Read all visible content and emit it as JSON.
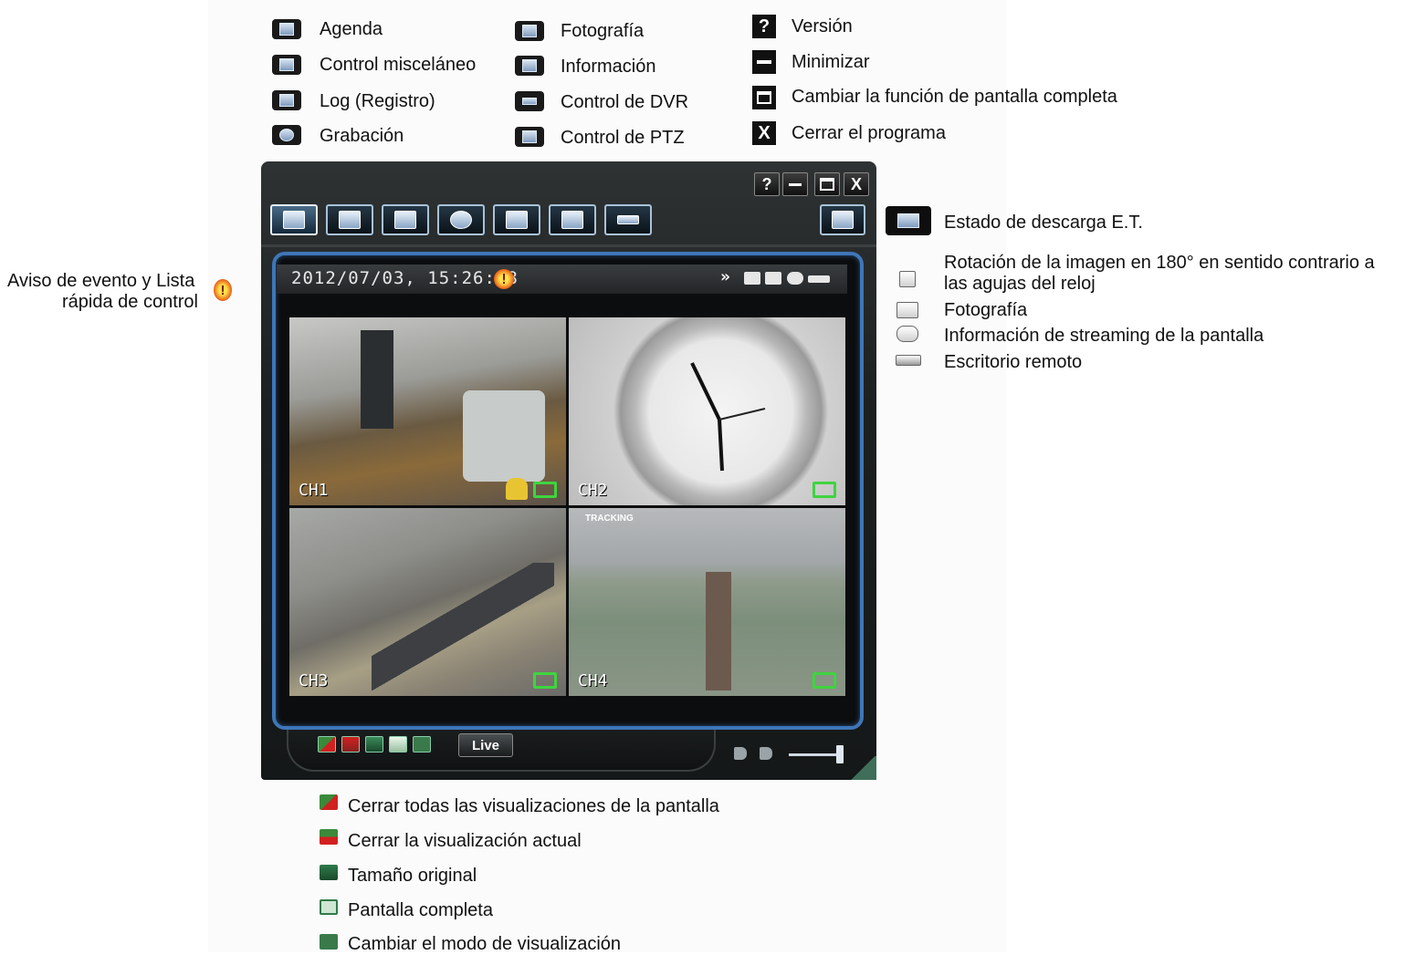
{
  "toolbar_legend": {
    "col1": [
      "Agenda",
      "Control misceláneo",
      "Log (Registro)",
      "Grabación"
    ],
    "col2": [
      "Fotografía",
      "Información",
      "Control de DVR",
      "Control de PTZ"
    ]
  },
  "window_legend": {
    "version": "Versión",
    "minimize": "Minimizar",
    "fullscreen": "Cambiar la función de pantalla completa",
    "close": "Cerrar el programa"
  },
  "event_note": {
    "line1": "Aviso de evento y Lista",
    "line2": "rápida de control"
  },
  "right_legend": {
    "download": "Estado de descarga E.T.",
    "rotate_line1": "Rotación de la imagen en 180° en sentido contrario a",
    "rotate_line2": "las agujas del reloj",
    "snapshot": "Fotografía",
    "streaming": "Información de streaming de la pantalla",
    "remote": "Escritorio remoto"
  },
  "bottom_legend": [
    "Cerrar todas las visualizaciones de la pantalla",
    "Cerrar la visualización actual",
    "Tamaño original",
    "Pantalla completa",
    "Cambiar el modo de visualización"
  ],
  "app": {
    "title_buttons": [
      "?",
      "—",
      "□",
      "X"
    ],
    "datetime": "2012/07/03, 15:26:18",
    "channels": [
      "CH1",
      "CH2",
      "CH3",
      "CH4"
    ],
    "ch4_overlay": "TRACKING",
    "live_button": "Live"
  },
  "icons": {
    "toolbar": [
      "agenda-icon",
      "misc-control-icon",
      "log-icon",
      "record-icon",
      "snapshot-icon",
      "info-icon",
      "dvr-control-icon",
      "ptz-control-icon"
    ],
    "status": [
      "rotate-icon",
      "snapshot-icon",
      "streaming-icon",
      "remote-desktop-icon"
    ]
  },
  "colors": {
    "frame_border": "#3e76b8",
    "rec_icon": "#3fd43f",
    "alert": "#e23a0a"
  }
}
